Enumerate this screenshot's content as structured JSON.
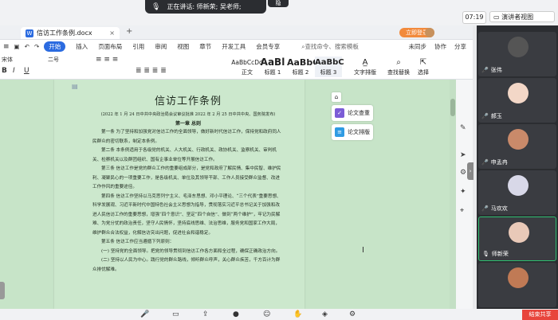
{
  "meeting": {
    "speaking_label": "正在讲话: 师新荣; 吴老师;",
    "top_mini_label": "隐",
    "clock": "07:19",
    "presenter_view": "演讲者视图"
  },
  "wps": {
    "doc_tab": "信访工作条例.docx",
    "new_tab": "+",
    "member_badge": "立即登录",
    "menu": [
      "开始",
      "插入",
      "页面布局",
      "引用",
      "审阅",
      "视图",
      "章节",
      "开发工具",
      "会员专享"
    ],
    "active_menu": "开始",
    "search": "查找命令、搜索模板",
    "menu_right": [
      "未同步",
      "协作",
      "分享"
    ],
    "ribbon": {
      "font_name": "宋体",
      "font_size": "二号",
      "styles": [
        {
          "sample": "AaBbCcDd",
          "label": "正文"
        },
        {
          "sample": "AaBl",
          "label": "标题 1"
        },
        {
          "sample": "AaBbC",
          "label": "标题 2"
        },
        {
          "sample": "AaBbC",
          "label": "标题 3"
        }
      ],
      "text_layout": "文字排版",
      "find_replace": "查找替换",
      "select": "选择"
    }
  },
  "document": {
    "title": "信访工作条例",
    "subtitle": "(2022 年 1 月 24 日中共中央政治局会议审议批准 2022 年 2 月 25 日中共中央、国务院发布)",
    "chapter": "第一章 总则",
    "paragraphs": [
      "第一条 为了坚持和加强党对信访工作的全面领导，做好新时代信访工作，保持党和政府同人民群众的密切联系，制定本条例。",
      "第二条 本条例适用于各级党的机关、人大机关、行政机关、政协机关、监察机关、审判机关、检察机关以及群团组织、国有企事业单位等开展信访工作。",
      "第三条 信访工作是党的群众工作的重要组成部分，是党和政府了解民情、集中民智、维护民利、凝聚民心的一项重要工作，是各级机关、单位及其领导干部、工作人员接受群众监督、改进工作作风的重要途径。",
      "第四条 信访工作坚持以马克思列宁主义、毛泽东思想、邓小平理论、“三个代表”重要思想、科学发展观、习近平新时代中国特色社会主义思想为指导，贯彻落实习近平总书记关于加强和改进人民信访工作的重要思想，增强“四个意识”、坚定“四个自信”、做到“两个维护”，牢记为民解难、为党分忧的政治责任，坚守人民情怀，坚持底线思维、法治思维，服务党和国家工作大局，维护群众合法权益，化解信访突出问题，促进社会和谐稳定。",
      "第五条 信访工作应当遵循下列原则：",
      "(一) 坚持党的全面领导。把党的领导贯彻到信访工作各方面和全过程，确保正确政治方向。",
      "(二) 坚持以人民为中心。践行党的群众路线，倾听群众呼声，关心群众疾苦，千方百计为群众排忧解难。"
    ],
    "side_tools": [
      {
        "label": "论文查重",
        "color": "#7b5cd6"
      },
      {
        "label": "论文排版",
        "color": "#2f9be3"
      }
    ]
  },
  "participants": [
    {
      "name": "张伟",
      "color": "#555555"
    },
    {
      "name": "郝玉",
      "color": "#f3d7c7"
    },
    {
      "name": "申孟冉",
      "color": "#c98a6a"
    },
    {
      "name": "马欢欢",
      "color": "#d8d8e8"
    },
    {
      "name": "师新荣",
      "color": "#e9c9b8"
    },
    {
      "name": "",
      "color": "#c07a55"
    }
  ],
  "bottom": {
    "red_button": "结束共享"
  }
}
